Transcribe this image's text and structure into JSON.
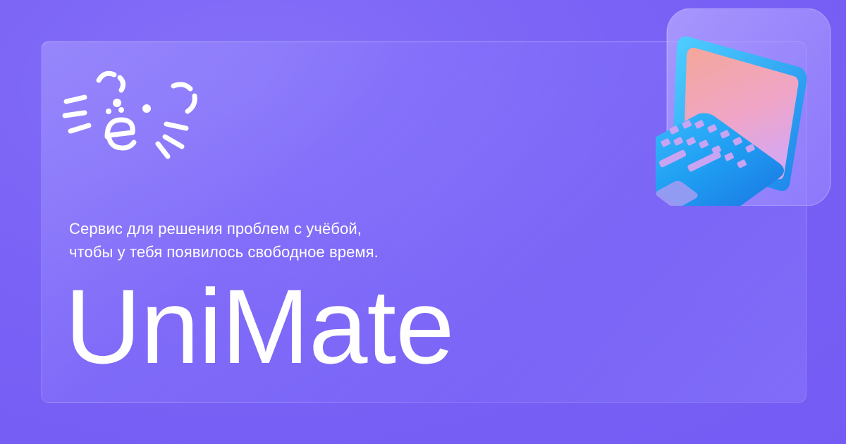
{
  "brand": {
    "name": "UniMate",
    "tagline_line1": "Сервис для решения проблем с учёбой,",
    "tagline_line2": "чтобы у тебя появилось свободное время."
  },
  "icons": {
    "logo": "cat-face-e-logo",
    "illustration": "laptop-icon"
  },
  "colors": {
    "background": "#7b64f7",
    "text": "#ffffff",
    "laptop_body": "#2a9cf0",
    "laptop_screen": "#f3a6b8",
    "laptop_keys": "#c9a4f3"
  }
}
